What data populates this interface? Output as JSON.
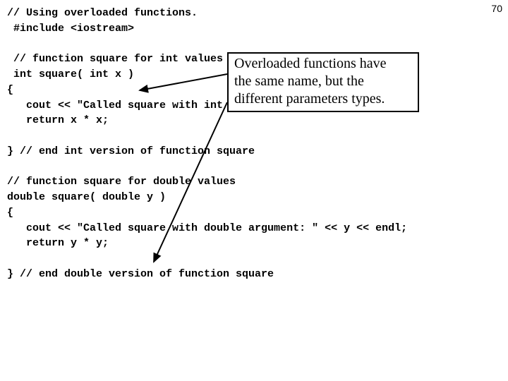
{
  "page_number": "70",
  "code": {
    "l1": "// Using overloaded functions.",
    "l2": " #include <iostream>",
    "l3": "",
    "l4": " // function square for int values",
    "l5": " int square( int x )",
    "l6": "{",
    "l7": "   cout << \"Called square with int argument: \" << x << endl;",
    "l8": "   return x * x;",
    "l9": "",
    "l10": "} // end int version of function square",
    "l11": "",
    "l12": "// function square for double values",
    "l13": "double square( double y )",
    "l14": "{",
    "l15": "   cout << \"Called square with double argument: \" << y << endl;",
    "l16": "   return y * y;",
    "l17": "",
    "l18": "} // end double version of function square"
  },
  "annotation": {
    "line1": "Overloaded functions have",
    "line2": "the same name, but the",
    "line3": "different parameters types."
  }
}
